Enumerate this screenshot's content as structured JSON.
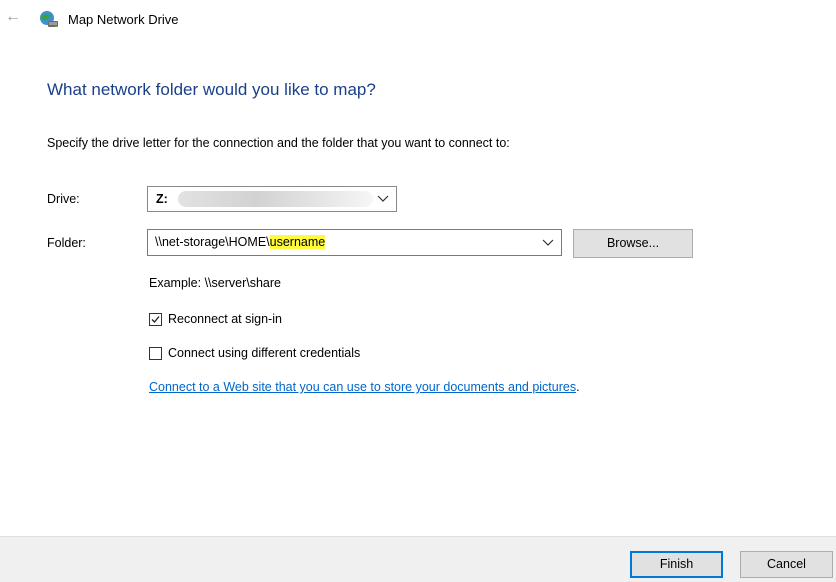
{
  "window": {
    "title": "Map Network Drive",
    "back_icon": "back-arrow-icon",
    "app_icon": "network-drive-icon"
  },
  "heading": "What network folder would you like to map?",
  "instruction": "Specify the drive letter for the connection and the folder that you want to connect to:",
  "drive": {
    "label": "Drive:",
    "value": "Z:"
  },
  "folder": {
    "label": "Folder:",
    "value_prefix": "\\\\net-storage\\HOME\\",
    "value_highlight": "username",
    "highlight_color": "#fffb3a"
  },
  "browse_label": "Browse...",
  "example": "Example: \\\\server\\share",
  "reconnect": {
    "label": "Reconnect at sign-in",
    "checked": true
  },
  "credentials": {
    "label": "Connect using different credentials",
    "checked": false
  },
  "web_link": {
    "text": "Connect to a Web site that you can use to store your documents and pictures",
    "suffix": "."
  },
  "buttons": {
    "finish": "Finish",
    "cancel": "Cancel"
  },
  "colors": {
    "heading": "#1a3f8a",
    "link": "#0066cc",
    "default_button_border": "#0078d7"
  }
}
